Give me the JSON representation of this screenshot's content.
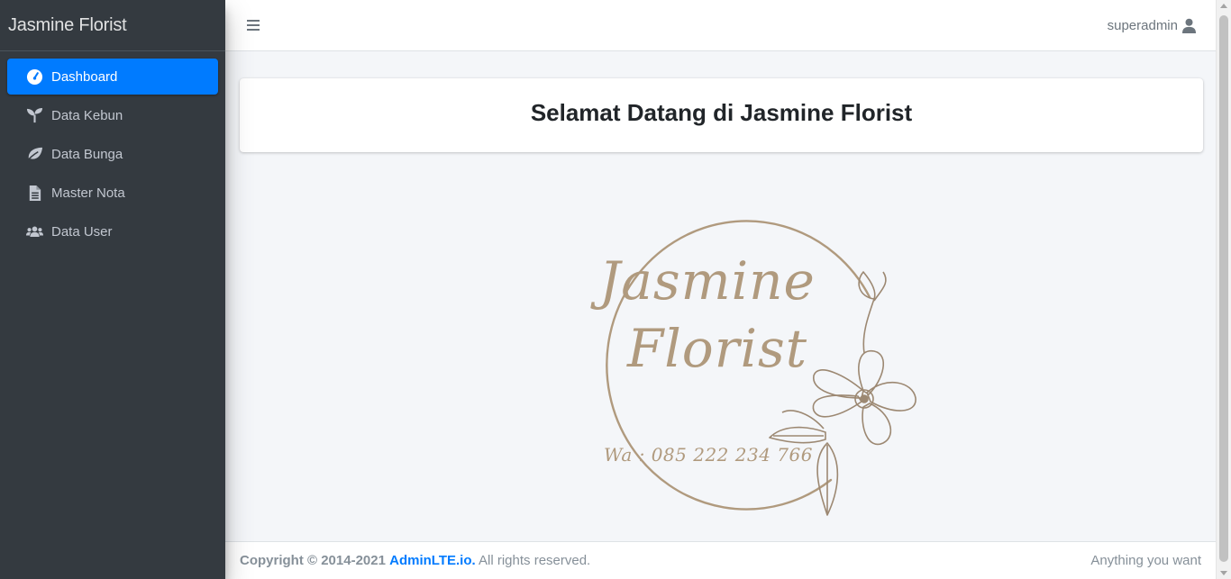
{
  "brand": {
    "title": "Jasmine Florist"
  },
  "sidebar": {
    "items": [
      {
        "label": "Dashboard",
        "icon": "tachometer-icon",
        "active": true
      },
      {
        "label": "Data Kebun",
        "icon": "seedling-icon",
        "active": false
      },
      {
        "label": "Data Bunga",
        "icon": "leaf-icon",
        "active": false
      },
      {
        "label": "Master Nota",
        "icon": "file-icon",
        "active": false
      },
      {
        "label": "Data User",
        "icon": "users-icon",
        "active": false
      }
    ]
  },
  "header": {
    "username": "superadmin"
  },
  "main": {
    "welcome_title": "Selamat Datang di Jasmine Florist",
    "logo": {
      "line1": "Jasmine",
      "line2": "Florist",
      "contact": "Wa : 085 222 234 766"
    }
  },
  "footer": {
    "copyright_prefix": "Copyright © 2014-2021",
    "link_text": "AdminLTE.io.",
    "suffix": "All rights reserved.",
    "right_text": "Anything you want"
  },
  "colors": {
    "sidebar_bg": "#343a40",
    "active_bg": "#007bff",
    "logo_gold": "#b09a7e"
  }
}
